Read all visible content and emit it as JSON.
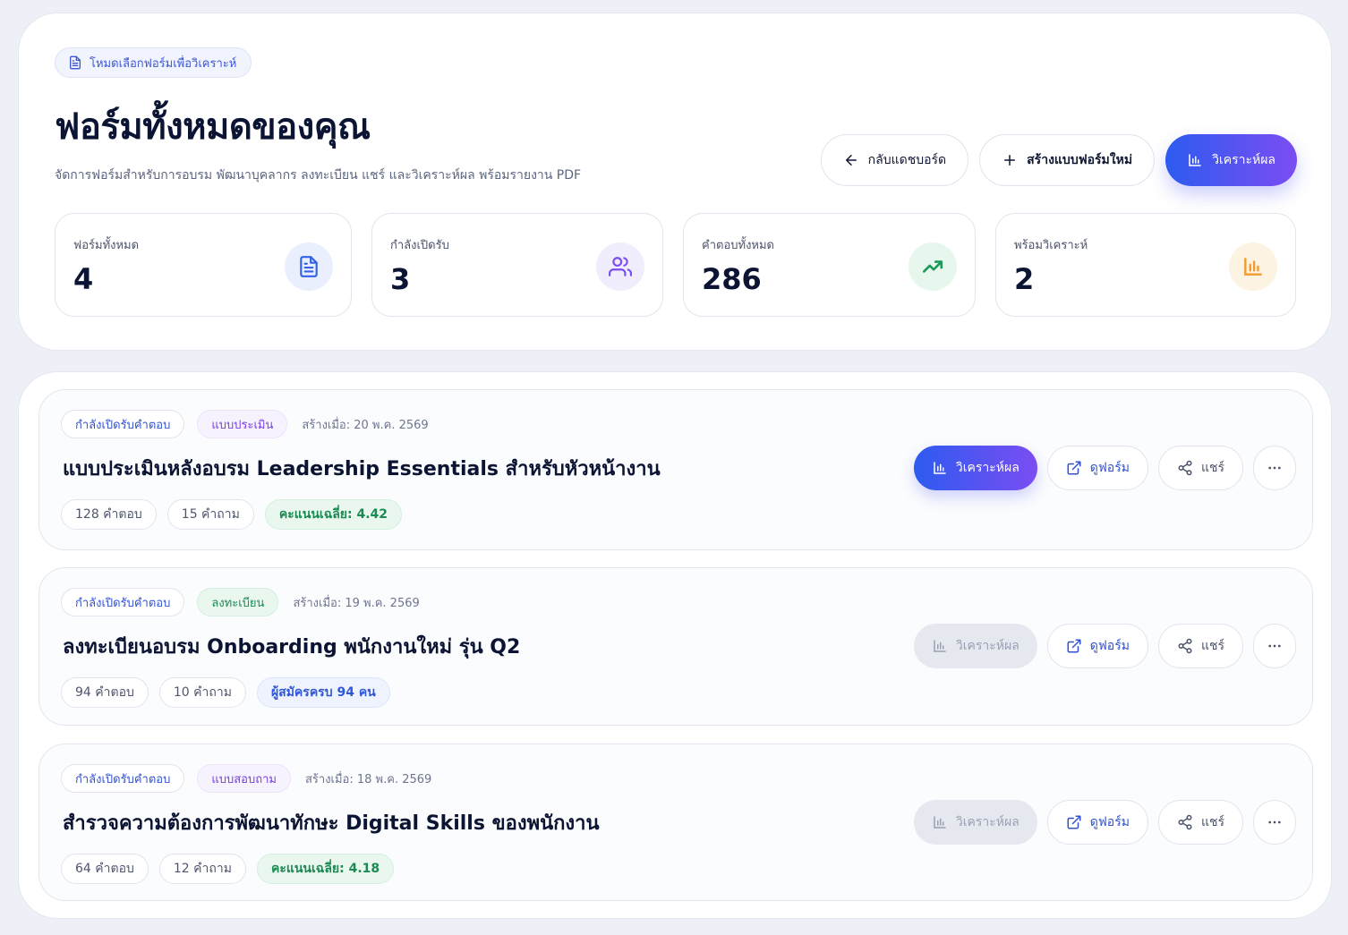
{
  "header": {
    "mode_chip": "โหมดเลือกฟอร์มเพื่อวิเคราะห์",
    "title": "ฟอร์มทั้งหมดของคุณ",
    "subtitle": "จัดการฟอร์มสำหรับการอบรม พัฒนาบุคลากร ลงทะเบียน แชร์ และวิเคราะห์ผล พร้อมรายงาน PDF",
    "actions": {
      "back_label": "กลับแดชบอร์ด",
      "new_label": "สร้างแบบฟอร์มใหม่",
      "analyze_label": "วิเคราะห์ผล"
    }
  },
  "stats": [
    {
      "label": "ฟอร์มทั้งหมด",
      "value": "4",
      "icon": "document-icon"
    },
    {
      "label": "กำลังเปิดรับ",
      "value": "3",
      "icon": "users-icon"
    },
    {
      "label": "คำตอบทั้งหมด",
      "value": "286",
      "icon": "trend-up-icon"
    },
    {
      "label": "พร้อมวิเคราะห์",
      "value": "2",
      "icon": "bar-chart-icon"
    }
  ],
  "forms": [
    {
      "status": "กำลังเปิดรับคำตอบ",
      "type": "แบบประเมิน",
      "created": "สร้างเมื่อ: 20 พ.ค. 2569",
      "title": "แบบประเมินหลังอบรม Leadership Essentials สำหรับหัวหน้างาน",
      "responses": "128 คำตอบ",
      "questions": "15 คำถาม",
      "extra": "คะแนนเฉลี่ย: 4.42",
      "analyze_enabled": true
    },
    {
      "status": "กำลังเปิดรับคำตอบ",
      "type": "ลงทะเบียน",
      "created": "สร้างเมื่อ: 19 พ.ค. 2569",
      "title": "ลงทะเบียนอบรม Onboarding พนักงานใหม่ รุ่น Q2",
      "responses": "94 คำตอบ",
      "questions": "10 คำถาม",
      "extra": "ผู้สมัครครบ 94 คน",
      "analyze_enabled": false
    },
    {
      "status": "กำลังเปิดรับคำตอบ",
      "type": "แบบสอบถาม",
      "created": "สร้างเมื่อ: 18 พ.ค. 2569",
      "title": "สำรวจความต้องการพัฒนาทักษะ Digital Skills ของพนักงาน",
      "responses": "64 คำตอบ",
      "questions": "12 คำถาม",
      "extra": "คะแนนเฉลี่ย: 4.18",
      "analyze_enabled": false
    }
  ],
  "card_actions": {
    "analyze_label": "วิเคราะห์ผล",
    "view_label": "ดูฟอร์ม",
    "share_label": "แชร์"
  },
  "colors": {
    "primary_start": "#2d5bf0",
    "primary_end": "#7b4df2",
    "green": "#1a8a52",
    "purple": "#7b3fe4"
  }
}
